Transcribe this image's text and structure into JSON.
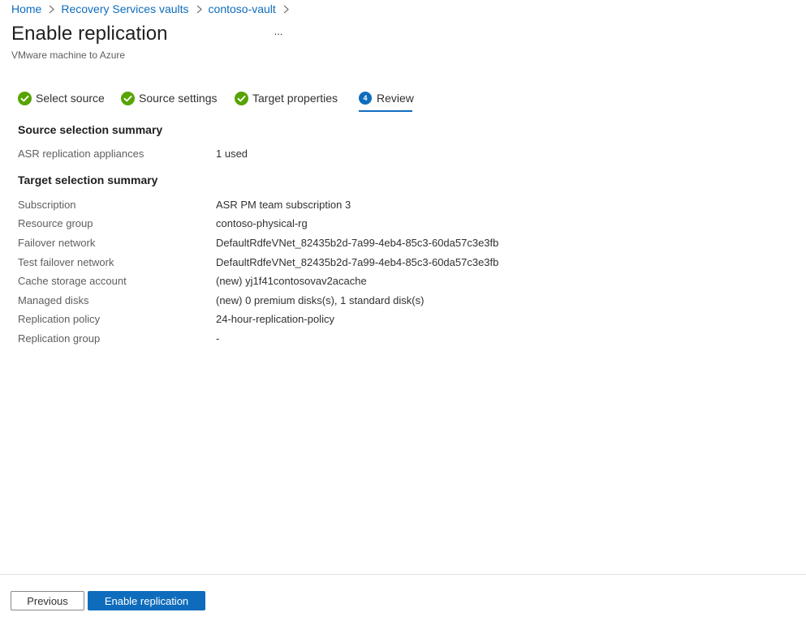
{
  "breadcrumb": {
    "items": [
      {
        "label": "Home"
      },
      {
        "label": "Recovery Services vaults"
      },
      {
        "label": "contoso-vault"
      }
    ]
  },
  "header": {
    "title": "Enable replication",
    "more_label": "...",
    "subtitle": "VMware machine to Azure"
  },
  "tabs": [
    {
      "label": "Select source",
      "state": "complete",
      "icon": "check-circle-icon"
    },
    {
      "label": "Source settings",
      "state": "complete",
      "icon": "check-circle-icon"
    },
    {
      "label": "Target properties",
      "state": "complete",
      "icon": "check-circle-icon"
    },
    {
      "label": "Review",
      "state": "active",
      "step_number": "4"
    }
  ],
  "source_summary": {
    "heading": "Source selection summary",
    "rows": [
      {
        "label": "ASR replication appliances",
        "value": "1 used"
      }
    ]
  },
  "target_summary": {
    "heading": "Target selection summary",
    "rows": [
      {
        "label": "Subscription",
        "value": "ASR PM team subscription 3"
      },
      {
        "label": "Resource group",
        "value": "contoso-physical-rg"
      },
      {
        "label": "Failover network",
        "value": "DefaultRdfeVNet_82435b2d-7a99-4eb4-85c3-60da57c3e3fb"
      },
      {
        "label": "Test failover network",
        "value": "DefaultRdfeVNet_82435b2d-7a99-4eb4-85c3-60da57c3e3fb"
      },
      {
        "label": "Cache storage account",
        "value": "(new) yj1f41contosovav2acache"
      },
      {
        "label": "Managed disks",
        "value": "(new) 0 premium disks(s), 1 standard disk(s)"
      },
      {
        "label": "Replication policy",
        "value": "24-hour-replication-policy"
      },
      {
        "label": "Replication group",
        "value": "-"
      }
    ]
  },
  "footer": {
    "previous_label": "Previous",
    "enable_label": "Enable replication"
  },
  "colors": {
    "accent": "#0f6cbd",
    "success": "#57a300",
    "label_text": "#605e5c"
  }
}
